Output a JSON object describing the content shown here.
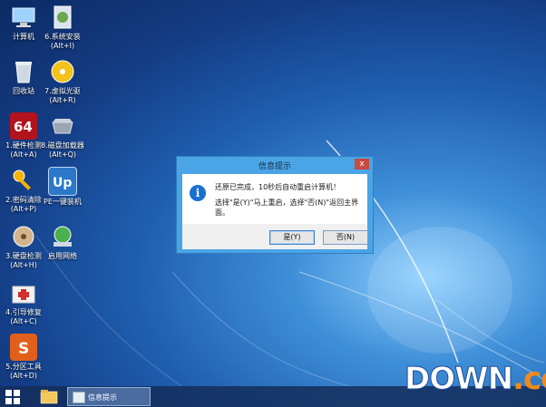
{
  "desktop": {
    "icons": [
      {
        "label": "计算机",
        "icon": "computer-icon"
      },
      {
        "label": "6.系统安装\n(Alt+I)",
        "icon": "system-install-icon"
      },
      {
        "label": "回收站",
        "icon": "recycle-bin-icon"
      },
      {
        "label": "7.虚拟光驱\n(Alt+R)",
        "icon": "virtual-drive-icon"
      },
      {
        "label": "1.硬件检测\n(Alt+A)",
        "icon": "hardware-test-icon"
      },
      {
        "label": "8.磁盘加载器\n(Alt+Q)",
        "icon": "disk-loader-icon"
      },
      {
        "label": "2.密码清除\n(Alt+P)",
        "icon": "password-clear-icon"
      },
      {
        "label": "PE一键装机",
        "icon": "pe-install-icon"
      },
      {
        "label": "3.硬盘检测\n(Alt+H)",
        "icon": "disk-test-icon"
      },
      {
        "label": "启用网络",
        "icon": "network-icon"
      },
      {
        "label": "4.引导修复\n(Alt+C)",
        "icon": "boot-repair-icon"
      },
      {
        "label": "5.分区工具\n(Alt+D)",
        "icon": "partition-tool-icon"
      }
    ]
  },
  "dialog": {
    "title": "信息提示",
    "close": "x",
    "message1": "还原已完成，10秒后自动重启计算机！",
    "message2": "选择\"是(Y)\"马上重启，选择\"否(N)\"返回主界面。",
    "yes_label": "是(Y)",
    "no_label": "否(N)"
  },
  "taskbar": {
    "task_label": "信息提示"
  },
  "watermark": {
    "text1": "DOWN",
    "text2": ".cc"
  },
  "colors": {
    "accent": "#4aa4e6",
    "close": "#c74b3e",
    "watermark_orange": "#f08a1c"
  }
}
